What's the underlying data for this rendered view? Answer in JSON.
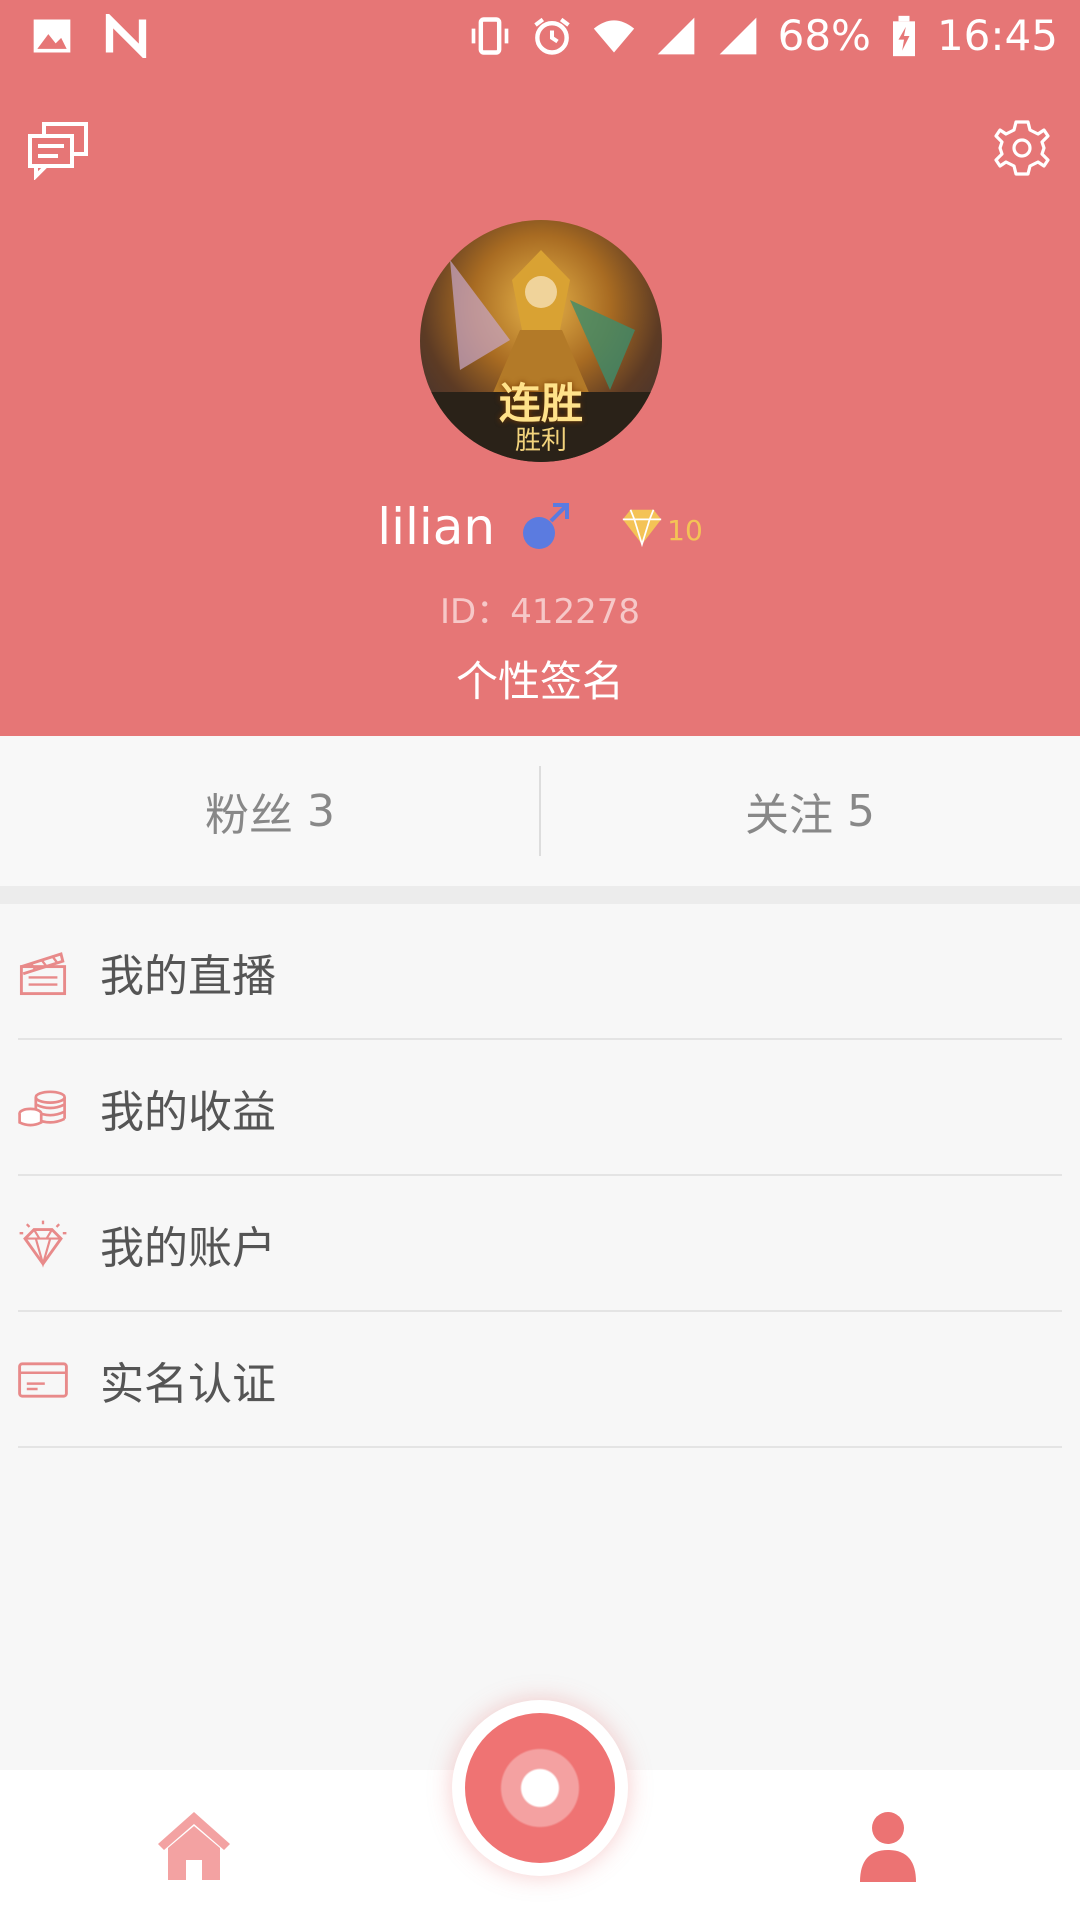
{
  "status_bar": {
    "battery": "68%",
    "time": "16:45"
  },
  "profile": {
    "username": "lilian",
    "level": "10",
    "id_text": "ID：412278",
    "signature": "个性签名",
    "avatar_text_1": "连胜",
    "avatar_text_2": "胜利"
  },
  "stats": {
    "fans_label": "粉丝",
    "fans_count": "3",
    "follow_label": "关注",
    "follow_count": "5"
  },
  "menu": {
    "items": [
      {
        "label": "我的直播",
        "icon": "clapperboard-icon"
      },
      {
        "label": "我的收益",
        "icon": "coins-icon"
      },
      {
        "label": "我的账户",
        "icon": "diamond-icon"
      },
      {
        "label": "实名认证",
        "icon": "id-card-icon"
      }
    ]
  },
  "colors": {
    "accent": "#e67676",
    "gender_male": "#5b7be0",
    "level_gold": "#f4c356"
  }
}
